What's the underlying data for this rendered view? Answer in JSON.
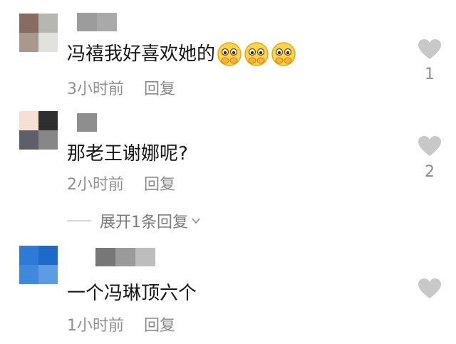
{
  "comments": [
    {
      "text": "冯禧我好喜欢她的",
      "emoji_icon": "shy-face-emoji",
      "time": "3小时前",
      "reply_label": "回复",
      "like_count": "1"
    },
    {
      "text": "那老王谢娜呢?",
      "time": "2小时前",
      "reply_label": "回复",
      "like_count": "2",
      "expand_label": "展开1条回复"
    },
    {
      "text": "一个冯琳顶六个",
      "time": "1小时前",
      "reply_label": "回复",
      "like_count": ""
    }
  ],
  "colors": {
    "text": "#151515",
    "meta": "#8f8f8f",
    "like_icon": "#c8c8c8"
  }
}
